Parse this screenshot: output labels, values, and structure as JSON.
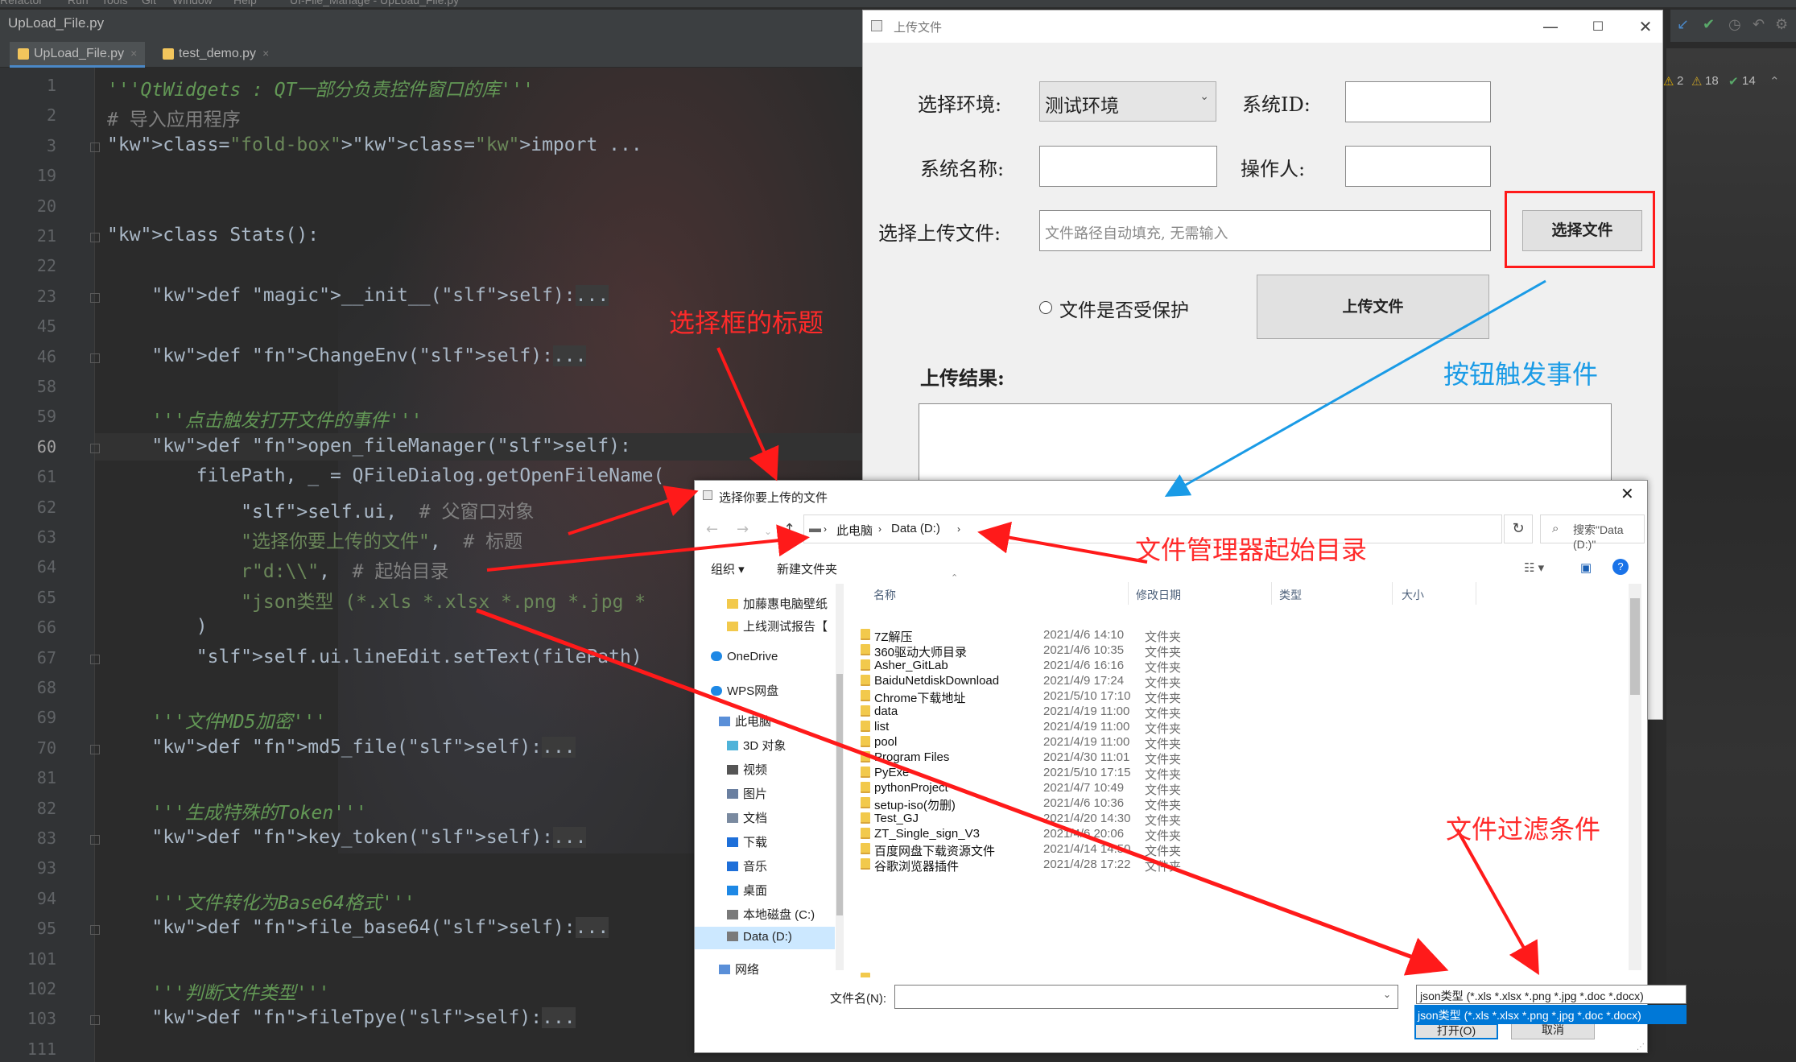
{
  "ide": {
    "menu_items": [
      "Refactor",
      "Run",
      "Tools",
      "Git",
      "Window",
      "Help"
    ],
    "menu_path": "UI-File_Manage - UpLoad_File.py",
    "file_title": "UpLoad_File.py",
    "tabs": [
      {
        "label": "UpLoad_File.py",
        "active": true
      },
      {
        "label": "test_demo.py",
        "active": false
      }
    ],
    "inspection": {
      "warnings": "2",
      "weak_warnings": "18",
      "typos": "14"
    },
    "code_lines": [
      {
        "n": "1",
        "text": "'''QtWidgets : QT一部分负责控件窗口的库'''"
      },
      {
        "n": "2",
        "text": "# 导入应用程序"
      },
      {
        "n": "3",
        "text": "import ..."
      },
      {
        "n": "19",
        "text": ""
      },
      {
        "n": "20",
        "text": ""
      },
      {
        "n": "21",
        "text": "class Stats():"
      },
      {
        "n": "22",
        "text": ""
      },
      {
        "n": "23",
        "text": "    def __init__(self):..."
      },
      {
        "n": "45",
        "text": ""
      },
      {
        "n": "46",
        "text": "    def ChangeEnv(self):..."
      },
      {
        "n": "58",
        "text": ""
      },
      {
        "n": "59",
        "text": "    '''点击触发打开文件的事件'''"
      },
      {
        "n": "60",
        "text": "    def open_fileManager(self):"
      },
      {
        "n": "61",
        "text": "        filePath, _ = QFileDialog.getOpenFileName("
      },
      {
        "n": "62",
        "text": "            self.ui,  # 父窗口对象"
      },
      {
        "n": "63",
        "text": "            \"选择你要上传的文件\",  # 标题"
      },
      {
        "n": "64",
        "text": "            r\"d:\\\\\",  # 起始目录"
      },
      {
        "n": "65",
        "text": "            \"json类型 (*.xls *.xlsx *.png *.jpg *"
      },
      {
        "n": "66",
        "text": "        )"
      },
      {
        "n": "67",
        "text": "        self.ui.lineEdit.setText(filePath)"
      },
      {
        "n": "68",
        "text": ""
      },
      {
        "n": "69",
        "text": "    '''文件MD5加密'''"
      },
      {
        "n": "70",
        "text": "    def md5_file(self):..."
      },
      {
        "n": "81",
        "text": ""
      },
      {
        "n": "82",
        "text": "    '''生成特殊的Token'''"
      },
      {
        "n": "83",
        "text": "    def key_token(self):..."
      },
      {
        "n": "93",
        "text": ""
      },
      {
        "n": "94",
        "text": "    '''文件转化为Base64格式'''"
      },
      {
        "n": "95",
        "text": "    def file_base64(self):..."
      },
      {
        "n": "101",
        "text": ""
      },
      {
        "n": "102",
        "text": "    '''判断文件类型'''"
      },
      {
        "n": "103",
        "text": "    def fileTpye(self):..."
      },
      {
        "n": "111",
        "text": ""
      }
    ]
  },
  "upload_window": {
    "title": "上传文件",
    "env_label": "选择环境:",
    "env_value": "测试环境",
    "system_id_label": "系统ID:",
    "system_name_label": "系统名称:",
    "operator_label": "操作人:",
    "file_label": "选择上传文件:",
    "file_placeholder": "文件路径自动填充, 无需输入",
    "choose_file_button": "选择文件",
    "protected_label": "文件是否受保护",
    "upload_button": "上传文件",
    "result_label": "上传结果:"
  },
  "file_dialog": {
    "title": "选择你要上传的文件",
    "breadcrumb": [
      "此电脑",
      "Data (D:)"
    ],
    "search_placeholder": "搜索\"Data (D:)\"",
    "organize": "组织 ▾",
    "new_folder": "新建文件夹",
    "nav_items": [
      {
        "label": "加藤惠电脑壁纸",
        "type": "folder"
      },
      {
        "label": "上线测试报告【",
        "type": "folder"
      },
      {
        "label": "OneDrive",
        "type": "cloud"
      },
      {
        "label": "WPS网盘",
        "type": "cloud"
      },
      {
        "label": "此电脑",
        "type": "pc"
      },
      {
        "label": "3D 对象",
        "type": "3d"
      },
      {
        "label": "视频",
        "type": "video"
      },
      {
        "label": "图片",
        "type": "pic"
      },
      {
        "label": "文档",
        "type": "doc"
      },
      {
        "label": "下载",
        "type": "down"
      },
      {
        "label": "音乐",
        "type": "music"
      },
      {
        "label": "桌面",
        "type": "desk"
      },
      {
        "label": "本地磁盘 (C:)",
        "type": "disk"
      },
      {
        "label": "Data (D:)",
        "type": "disk",
        "selected": true
      },
      {
        "label": "网络",
        "type": "net"
      }
    ],
    "columns": [
      "名称",
      "修改日期",
      "类型",
      "大小"
    ],
    "rows": [
      {
        "name": "7Z解压",
        "date": "2021/4/6 14:10",
        "type": "文件夹"
      },
      {
        "name": "360驱动大师目录",
        "date": "2021/4/6 10:35",
        "type": "文件夹"
      },
      {
        "name": "Asher_GitLab",
        "date": "2021/4/6 16:16",
        "type": "文件夹"
      },
      {
        "name": "BaiduNetdiskDownload",
        "date": "2021/4/9 17:24",
        "type": "文件夹"
      },
      {
        "name": "Chrome下载地址",
        "date": "2021/5/10 17:10",
        "type": "文件夹"
      },
      {
        "name": "data",
        "date": "2021/4/19 11:00",
        "type": "文件夹"
      },
      {
        "name": "list",
        "date": "2021/4/19 11:00",
        "type": "文件夹"
      },
      {
        "name": "pool",
        "date": "2021/4/19 11:00",
        "type": "文件夹"
      },
      {
        "name": "Program Files",
        "date": "2021/4/30 11:01",
        "type": "文件夹"
      },
      {
        "name": "PyExe",
        "date": "2021/5/10 17:15",
        "type": "文件夹"
      },
      {
        "name": "pythonProject",
        "date": "2021/4/7 10:49",
        "type": "文件夹"
      },
      {
        "name": "setup-iso(勿删)",
        "date": "2021/4/6 10:36",
        "type": "文件夹"
      },
      {
        "name": "Test_GJ",
        "date": "2021/4/20 14:30",
        "type": "文件夹"
      },
      {
        "name": "ZT_Single_sign_V3",
        "date": "2021/4/6 20:06",
        "type": "文件夹"
      },
      {
        "name": "百度网盘下载资源文件",
        "date": "2021/4/14 14:50",
        "type": "文件夹"
      },
      {
        "name": "谷歌浏览器插件",
        "date": "2021/4/28 17:22",
        "type": "文件夹"
      }
    ],
    "filename_label": "文件名(N):",
    "filter_value": "json类型 (*.xls *.xlsx *.png *.jpg *.doc *.docx)",
    "filter_option": "json类型 (*.xls *.xlsx *.png *.jpg *.doc *.docx)",
    "open_button": "打开(O)",
    "cancel_button": "取消"
  },
  "annotations": {
    "dialog_title": "选择框的标题",
    "button_event": "按钮触发事件",
    "start_dir": "文件管理器起始目录",
    "filter": "文件过滤条件"
  },
  "colors": {
    "annotation_red": "#ff2a2a",
    "annotation_blue": "#1a9be6",
    "selection_blue": "#0078d7"
  }
}
